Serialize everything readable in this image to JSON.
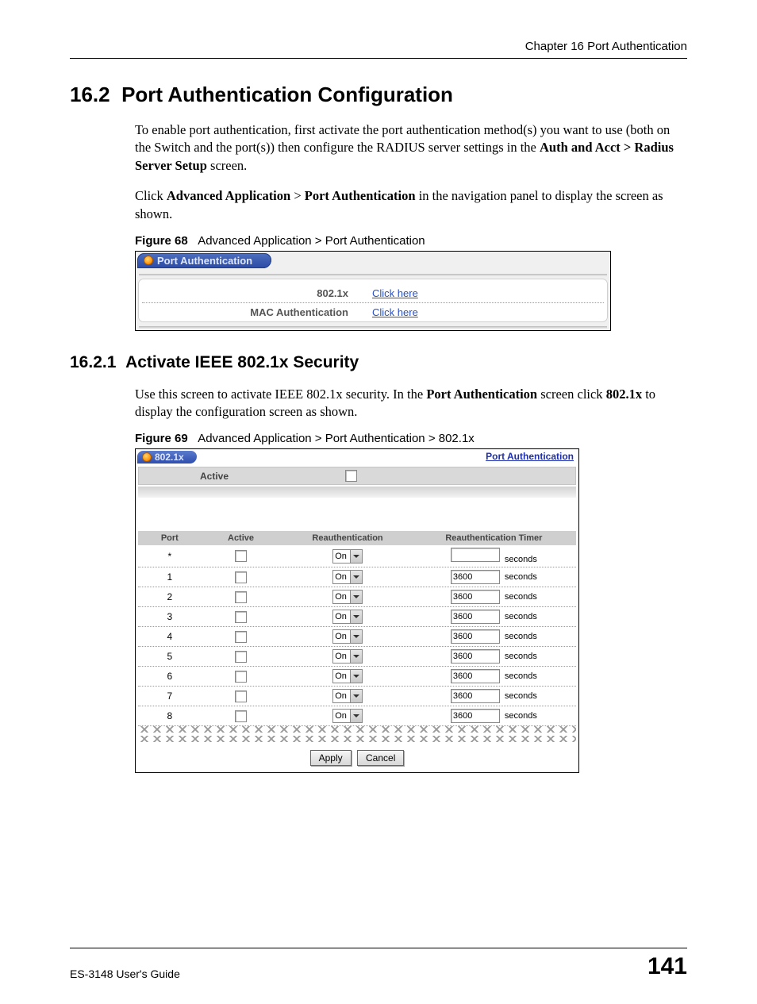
{
  "header": {
    "chapter": "Chapter 16 Port Authentication"
  },
  "section": {
    "number": "16.2",
    "title": "Port Authentication Configuration",
    "para1_a": "To enable port authentication, first activate the port authentication method(s) you want to use (both on the Switch and the port(s)) then configure the RADIUS server settings in the ",
    "para1_bold": "Auth and Acct > Radius Server Setup",
    "para1_b": " screen.",
    "para2_a": "Click ",
    "para2_b1": "Advanced Application",
    "para2_mid": " > ",
    "para2_b2": "Port Authentication",
    "para2_c": " in the navigation panel to display the screen as shown."
  },
  "figure68": {
    "label": "Figure 68",
    "caption": "Advanced Application > Port Authentication",
    "tab_title": "Port Authentication",
    "row1_label": "802.1x",
    "row2_label": "MAC Authentication",
    "link_text": "Click here"
  },
  "subsection": {
    "number": "16.2.1",
    "title": "Activate IEEE 802.1x Security",
    "para_a": "Use this screen to activate IEEE 802.1x security. In the ",
    "para_b1": "Port Authentication",
    "para_mid": " screen click ",
    "para_b2": "802.1x",
    "para_c": " to display the configuration screen as shown."
  },
  "figure69": {
    "label": "Figure 69",
    "caption": "Advanced Application > Port Authentication > 802.1x",
    "tab_title": "802.1x",
    "top_link": "Port Authentication",
    "active_label": "Active",
    "headers": {
      "port": "Port",
      "active": "Active",
      "reauth": "Reauthentication",
      "timer": "Reauthentication Timer"
    },
    "dropdown_value": "On",
    "seconds_label": "seconds",
    "rows": [
      {
        "port": "*",
        "timer": ""
      },
      {
        "port": "1",
        "timer": "3600"
      },
      {
        "port": "2",
        "timer": "3600"
      },
      {
        "port": "3",
        "timer": "3600"
      },
      {
        "port": "4",
        "timer": "3600"
      },
      {
        "port": "5",
        "timer": "3600"
      },
      {
        "port": "6",
        "timer": "3600"
      },
      {
        "port": "7",
        "timer": "3600"
      },
      {
        "port": "8",
        "timer": "3600"
      }
    ],
    "apply_label": "Apply",
    "cancel_label": "Cancel"
  },
  "footer": {
    "guide": "ES-3148 User's Guide",
    "page": "141"
  }
}
